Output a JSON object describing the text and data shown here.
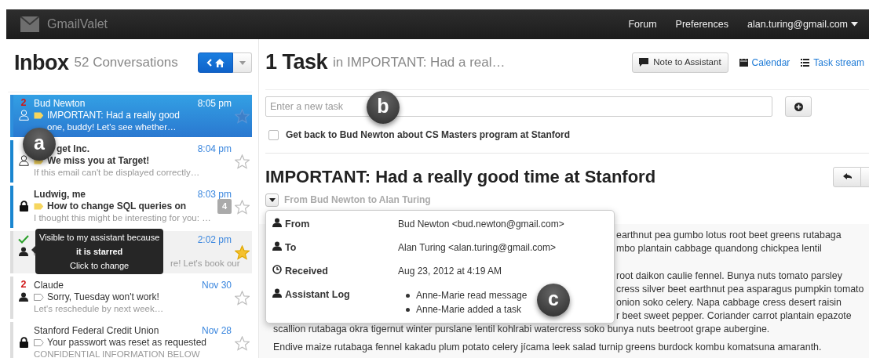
{
  "navbar": {
    "brand": "GmailValet",
    "links": [
      {
        "label": "Forum"
      },
      {
        "label": "Preferences"
      }
    ],
    "account": "alan.turing@gmail.com"
  },
  "inbox": {
    "title": "Inbox",
    "count": "52 Conversations",
    "items": [
      {
        "kind": "hidden",
        "sender": "Bud Newton",
        "count": "2",
        "time": "8:05 pm",
        "important": true,
        "subject": "IMPORTANT: Had a really good",
        "preview": "one, buddy! Let's see whether…",
        "unread": false,
        "selected": true,
        "hovered": false,
        "starred": false,
        "verified": false
      },
      {
        "kind": "hidden",
        "sender": "get Inc.",
        "time": "8:04 pm",
        "important": true,
        "subject": "We miss you at Target!",
        "preview": "If this email can't be displayed correctly…",
        "unread": true,
        "selected": false,
        "hovered": false,
        "starred": false,
        "verified": false
      },
      {
        "kind": "private",
        "sender": "Ludwig, me",
        "time": "8:03 pm",
        "important": true,
        "subject": "How to change SQL queries on",
        "badge": "4",
        "preview": "I thought this might be interesting for you: …",
        "unread": true,
        "selected": false,
        "hovered": false,
        "starred": false,
        "verified": false
      },
      {
        "kind": "shared",
        "time": "2:02 pm",
        "important": false,
        "preview": "re! Let's book our",
        "unread": false,
        "selected": false,
        "hovered": true,
        "starred": true,
        "verified": true,
        "tooltip": [
          {
            "text": "Visible to my assistant because",
            "emphasis": false
          },
          {
            "text": "it is starred",
            "emphasis": true
          },
          {
            "text": "Click to change",
            "emphasis": false
          }
        ]
      },
      {
        "kind": "shared",
        "sender": "Claude",
        "count": "2",
        "time": "Nov 30",
        "important": false,
        "subject": "Sorry, Tuesday won't work!",
        "preview": "Let's reschedule by next week…",
        "unread": false,
        "selected": false,
        "hovered": false,
        "starred": false,
        "verified": false
      },
      {
        "kind": "private",
        "sender": "Stanford Federal Credit Union",
        "time": "Nov 28",
        "important": false,
        "subject": "Your passwort was reset as requested",
        "preview": "CONFIDENTIAL INFORMATION BELOW",
        "unread": false,
        "selected": false,
        "hovered": false,
        "starred": false,
        "verified": false
      }
    ]
  },
  "tasks": {
    "title": "1 Task",
    "context": "in IMPORTANT: Had a real…",
    "note_button": "Note to Assistant",
    "links": [
      {
        "label": "Calendar"
      },
      {
        "label": "Task stream"
      }
    ],
    "placeholder": "Enter a new task",
    "items": [
      {
        "text": "Get back to Bud Newton about CS Masters program at Stanford",
        "done": false
      }
    ]
  },
  "message": {
    "subject": "IMPORTANT: Had a really good time at Stanford",
    "summary": "From Bud Newton to Alan Turing",
    "details": [
      {
        "kind": "contact",
        "label": "From",
        "value": "Bud Newton <bud.newton@gmail.com>"
      },
      {
        "kind": "contact",
        "label": "To",
        "value": "Alan Turing <alan.turing@gmail.com>"
      },
      {
        "kind": "date",
        "label": "Received",
        "value": "Aug 23, 2012 at 4:19 AM"
      },
      {
        "kind": "contact",
        "label": "Assistant Log",
        "entries": [
          "Anne-Marie read message",
          "Anne-Marie added a task"
        ]
      }
    ],
    "paragraphs": [
      {
        "lines": [
          {
            "text": "earthnut pea gumbo lotus root beet greens rutabaga",
            "beside": true
          },
          {
            "text": "mbo plantain cabbage quandong chickpea lentil",
            "beside": true
          }
        ]
      },
      {
        "lines": [
          {
            "text": "root daikon caulie fennel. Bunya nuts tomato parsley",
            "beside": true
          },
          {
            "text": "cress silver beet earthnut pea asparagus pumpkin tomato",
            "beside": true
          },
          {
            "text": "onion soko celery. Napa cabbage cress desert raisin",
            "beside": true
          },
          {
            "text": "r beet sweet pepper. Coriander carrot plantain epazote",
            "beside": true
          },
          {
            "text": "scallion rutabaga okra tigernut winter purslane lentil kohlrabi watercress soko bunya nuts beetroot grape aubergine.",
            "beside": false
          }
        ]
      },
      {
        "lines": [
          {
            "text": "Endive maize rutabaga fennel kakadu plum potato celery jícama leek salad turnip greens burdock kombu komatsuna amaranth.",
            "beside": false
          }
        ]
      }
    ]
  },
  "annotations": [
    {
      "label": "a"
    },
    {
      "label": "b"
    },
    {
      "label": "c"
    }
  ]
}
